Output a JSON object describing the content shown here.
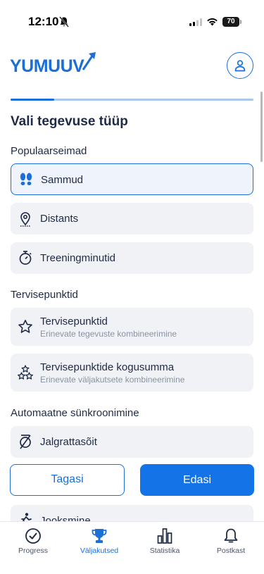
{
  "status_bar": {
    "time": "12:10",
    "battery": "70"
  },
  "header": {
    "logo_text": "YUMUUV"
  },
  "progress": {
    "fraction": 0.18
  },
  "page_title": "Vali tegevuse tüüp",
  "sections": {
    "popular": "Populaarseimad",
    "health": "Tervisepunktid",
    "sync": "Automaatne sünkroonimine"
  },
  "options": [
    {
      "label": "Sammud",
      "icon": "footsteps-icon",
      "selected": true
    },
    {
      "label": "Distants",
      "icon": "location-pin-icon"
    },
    {
      "label": "Treeningminutid",
      "icon": "stopwatch-icon"
    },
    {
      "label": "Tervisepunktid",
      "sub": "Erinevate tegevuste kombineerimine",
      "icon": "star-icon"
    },
    {
      "label": "Tervisepunktide kogusumma",
      "sub": "Erinevate väljakutsete kombineerimine",
      "icon": "stars-cluster-icon"
    },
    {
      "label": "Jalgrattasõit",
      "icon": "bicycle-icon"
    },
    {
      "label": "Jooksmine",
      "icon": "running-icon"
    }
  ],
  "buttons": {
    "back": "Tagasi",
    "next": "Edasi"
  },
  "tabs": [
    {
      "label": "Progress",
      "icon": "gauge-icon"
    },
    {
      "label": "Väljakutsed",
      "icon": "trophy-icon",
      "active": true
    },
    {
      "label": "Statistika",
      "icon": "bar-chart-icon"
    },
    {
      "label": "Postkast",
      "icon": "bell-icon"
    }
  ],
  "colors": {
    "accent": "#1b6fd6",
    "button": "#1473e6",
    "card": "#f1f2f6"
  }
}
